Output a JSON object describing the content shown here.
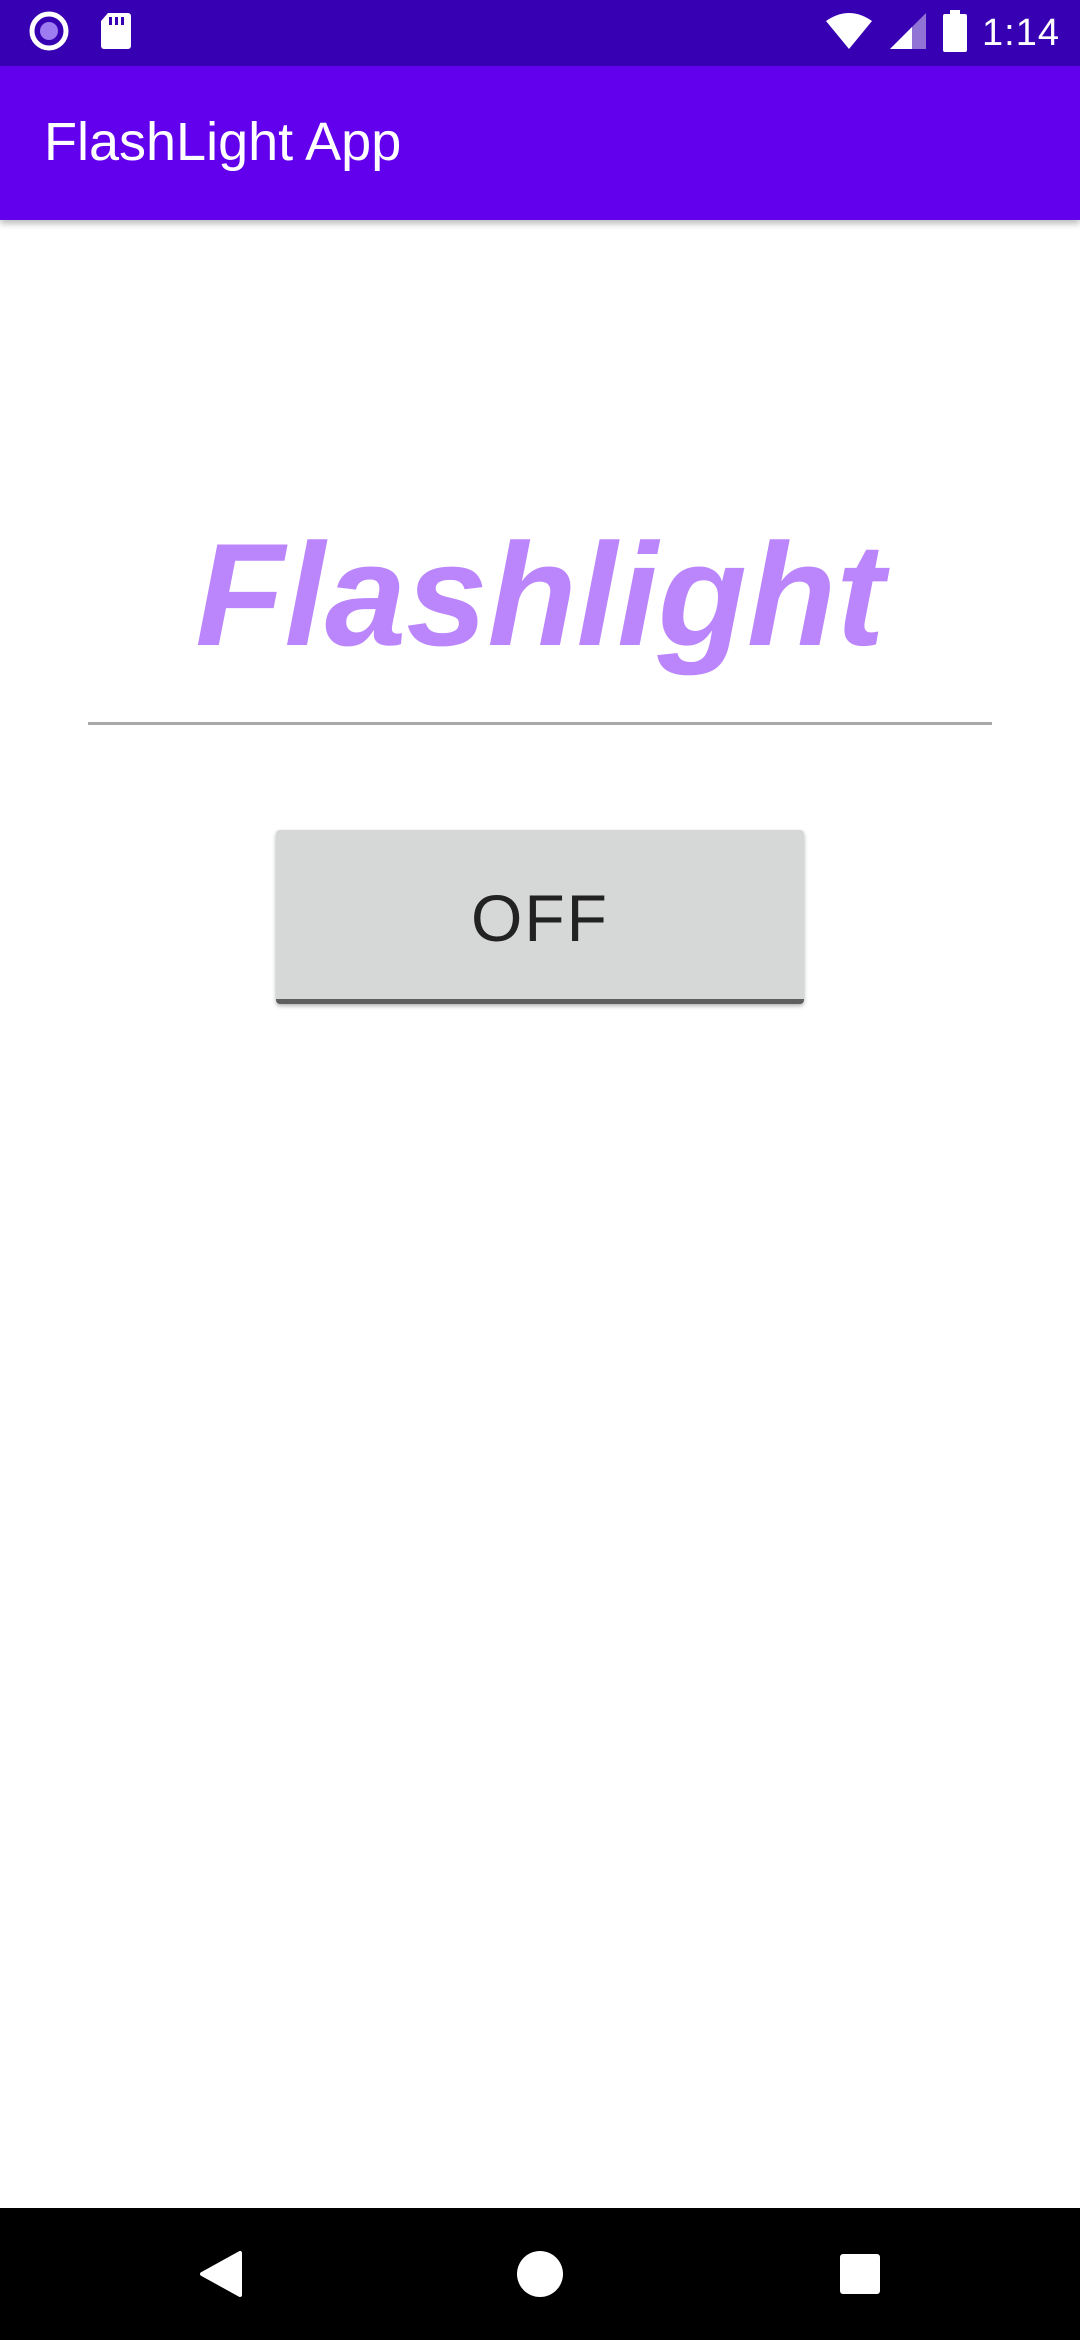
{
  "status_bar": {
    "time": "1:14",
    "icons": [
      "notification-circle-icon",
      "sd-card-icon",
      "wifi-icon",
      "cell-signal-icon",
      "battery-icon"
    ],
    "background": "#3700b3"
  },
  "app_bar": {
    "title": "FlashLight App",
    "background": "#6200ee"
  },
  "main": {
    "heading": "Flashlight",
    "heading_color": "#bb86fc",
    "toggle_button_label": "OFF"
  },
  "nav_bar": {
    "icons": [
      "back-icon",
      "home-icon",
      "recents-icon"
    ]
  }
}
